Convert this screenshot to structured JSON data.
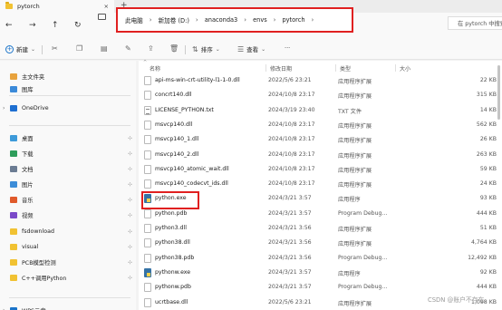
{
  "tab": {
    "title": "pytorch",
    "close": "×",
    "add": "+"
  },
  "nav": {
    "back": "←",
    "forward": "→",
    "up": "↑",
    "refresh": "↻"
  },
  "breadcrumb": [
    "此电脑",
    "新加卷 (D:)",
    "anaconda3",
    "envs",
    "pytorch"
  ],
  "breadcrumb_sep": "›",
  "search": {
    "placeholder": "在 pytorch 中搜索"
  },
  "toolbar": {
    "new_label": "新建",
    "new_chevron": "⌄",
    "sort_label": "排序",
    "view_label": "查看",
    "more": "···"
  },
  "sidebar": {
    "items": [
      {
        "label": "主文件夹",
        "icon": "home-icon",
        "color": "#e8a33d"
      },
      {
        "label": "图库",
        "icon": "gallery-icon",
        "color": "#3b8ad9"
      },
      {
        "label": "OneDrive",
        "icon": "cloud-icon",
        "color": "#1f6fd1"
      },
      {
        "label": "桌面",
        "icon": "desktop-icon",
        "color": "#3d9ad9"
      },
      {
        "label": "下载",
        "icon": "download-icon",
        "color": "#2e9d5b"
      },
      {
        "label": "文档",
        "icon": "documents-icon",
        "color": "#6b7c93"
      },
      {
        "label": "图片",
        "icon": "pictures-icon",
        "color": "#3c8dd8"
      },
      {
        "label": "音乐",
        "icon": "music-icon",
        "color": "#e05a2b"
      },
      {
        "label": "视频",
        "icon": "video-icon",
        "color": "#7b4ac9"
      },
      {
        "label": "fsdownload",
        "icon": "folder-icon",
        "color": "#f1c232"
      },
      {
        "label": "visual",
        "icon": "folder-icon",
        "color": "#f1c232"
      },
      {
        "label": "PCB模型检测",
        "icon": "folder-icon",
        "color": "#f1c232"
      },
      {
        "label": "C++调用Python",
        "icon": "folder-icon",
        "color": "#f1c232"
      },
      {
        "label": "WPS云盘",
        "icon": "wps-cloud-icon",
        "color": "#1a73c9"
      }
    ],
    "pin": "⊹",
    "chevron": "›"
  },
  "columns": {
    "name": "名称",
    "date": "修改日期",
    "type": "类型",
    "size": "大小",
    "sort_arrow": "^"
  },
  "files": [
    {
      "name": "api-ms-win-crt-utility-l1-1-0.dll",
      "date": "2022/5/6 23:21",
      "type": "应用程序扩展",
      "size": "22 KB",
      "kind": "dll"
    },
    {
      "name": "concrt140.dll",
      "date": "2024/10/8 23:17",
      "type": "应用程序扩展",
      "size": "315 KB",
      "kind": "dll"
    },
    {
      "name": "LICENSE_PYTHON.txt",
      "date": "2024/3/19 23:40",
      "type": "TXT 文件",
      "size": "14 KB",
      "kind": "txt"
    },
    {
      "name": "msvcp140.dll",
      "date": "2024/10/8 23:17",
      "type": "应用程序扩展",
      "size": "562 KB",
      "kind": "dll"
    },
    {
      "name": "msvcp140_1.dll",
      "date": "2024/10/8 23:17",
      "type": "应用程序扩展",
      "size": "26 KB",
      "kind": "dll"
    },
    {
      "name": "msvcp140_2.dll",
      "date": "2024/10/8 23:17",
      "type": "应用程序扩展",
      "size": "263 KB",
      "kind": "dll"
    },
    {
      "name": "msvcp140_atomic_wait.dll",
      "date": "2024/10/8 23:17",
      "type": "应用程序扩展",
      "size": "59 KB",
      "kind": "dll"
    },
    {
      "name": "msvcp140_codecvt_ids.dll",
      "date": "2024/10/8 23:17",
      "type": "应用程序扩展",
      "size": "24 KB",
      "kind": "dll"
    },
    {
      "name": "python.exe",
      "date": "2024/3/21 3:57",
      "type": "应用程序",
      "size": "93 KB",
      "kind": "py"
    },
    {
      "name": "python.pdb",
      "date": "2024/3/21 3:57",
      "type": "Program Debug...",
      "size": "444 KB",
      "kind": "dll"
    },
    {
      "name": "python3.dll",
      "date": "2024/3/21 3:56",
      "type": "应用程序扩展",
      "size": "51 KB",
      "kind": "dll"
    },
    {
      "name": "python38.dll",
      "date": "2024/3/21 3:56",
      "type": "应用程序扩展",
      "size": "4,764 KB",
      "kind": "dll"
    },
    {
      "name": "python38.pdb",
      "date": "2024/3/21 3:56",
      "type": "Program Debug...",
      "size": "12,492 KB",
      "kind": "dll"
    },
    {
      "name": "pythonw.exe",
      "date": "2024/3/21 3:57",
      "type": "应用程序",
      "size": "92 KB",
      "kind": "py"
    },
    {
      "name": "pythonw.pdb",
      "date": "2024/3/21 3:57",
      "type": "Program Debug...",
      "size": "444 KB",
      "kind": "dll"
    },
    {
      "name": "ucrtbase.dll",
      "date": "2022/5/6 23:21",
      "type": "应用程序扩展",
      "size": "1,098 KB",
      "kind": "dll"
    }
  ],
  "watermark": "CSDN @账户不存在",
  "colors": {
    "highlight": "#e02020",
    "accent": "#1a73c9"
  }
}
